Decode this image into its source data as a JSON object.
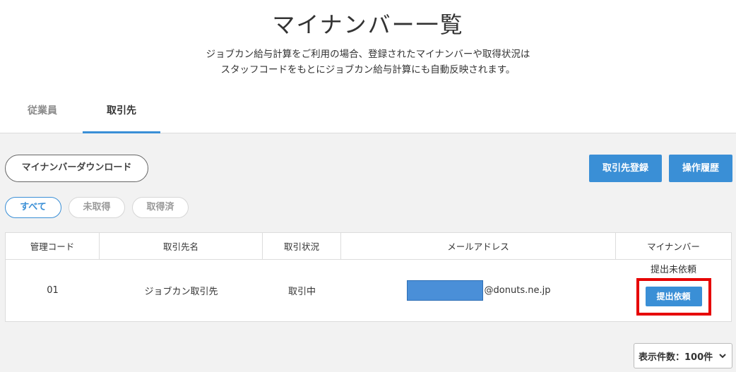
{
  "header": {
    "title": "マイナンバー一覧",
    "desc_line1": "ジョブカン給与計算をご利用の場合、登録されたマイナンバーや取得状況は",
    "desc_line2": "スタッフコードをもとにジョブカン給与計算にも自動反映されます。"
  },
  "tabs": [
    {
      "label": "従業員"
    },
    {
      "label": "取引先"
    }
  ],
  "toolbar": {
    "download_label": "マイナンバーダウンロード",
    "register_label": "取引先登録",
    "history_label": "操作履歴"
  },
  "filters": [
    {
      "label": "すべて"
    },
    {
      "label": "未取得"
    },
    {
      "label": "取得済"
    }
  ],
  "table": {
    "columns": [
      "管理コード",
      "取引先名",
      "取引状況",
      "メールアドレス",
      "マイナンバー"
    ],
    "rows": [
      {
        "code": "01",
        "name": "ジョブカン取引先",
        "status": "取引中",
        "email_domain": "@donuts.ne.jp",
        "mynumber_status": "提出未依頼",
        "request_label": "提出依頼"
      }
    ]
  },
  "pagination": {
    "per_page_label": "表示件数：100件"
  },
  "colors": {
    "accent": "#3a8fd6",
    "highlight": "#e60000"
  }
}
